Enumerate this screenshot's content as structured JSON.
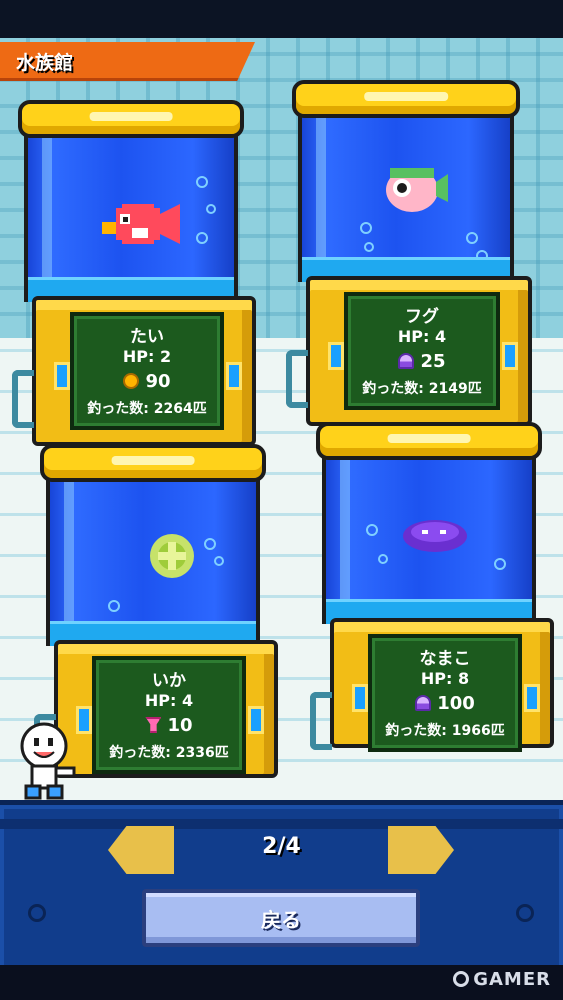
{
  "header": {
    "title": "水族館"
  },
  "tanks": [
    {
      "fish": "tai-fish",
      "name": "たい",
      "hp": "HP: 2",
      "cost_icon": "coin-icon",
      "cost": "90",
      "count": "釣った数: 2264匹"
    },
    {
      "fish": "fugu-fish",
      "name": "フグ",
      "hp": "HP: 4",
      "cost_icon": "jellyfish-icon",
      "cost": "25",
      "count": "釣った数: 2149匹"
    },
    {
      "fish": "ika-squid",
      "name": "いか",
      "hp": "HP: 4",
      "cost_icon": "shell-icon",
      "cost": "10",
      "count": "釣った数: 2336匹"
    },
    {
      "fish": "namako-sea-cucumber",
      "name": "なまこ",
      "hp": "HP: 8",
      "cost_icon": "jellyfish-icon",
      "cost": "100",
      "count": "釣った数: 1966匹"
    }
  ],
  "pager": {
    "indicator": "2/4",
    "prev_icon": "left-arrow-icon",
    "next_icon": "right-arrow-icon"
  },
  "footer": {
    "back_label": "戻る"
  },
  "watermark": "GAMER",
  "colors": {
    "title_bar": "#ee6a14",
    "tank_frame": "#ffd21a",
    "water": "#1d53f0",
    "plate": "#1c5a1e",
    "bottom_panel": "#113d8c",
    "arrow": "#e8c04a",
    "back_button": "#a8bdf2"
  }
}
